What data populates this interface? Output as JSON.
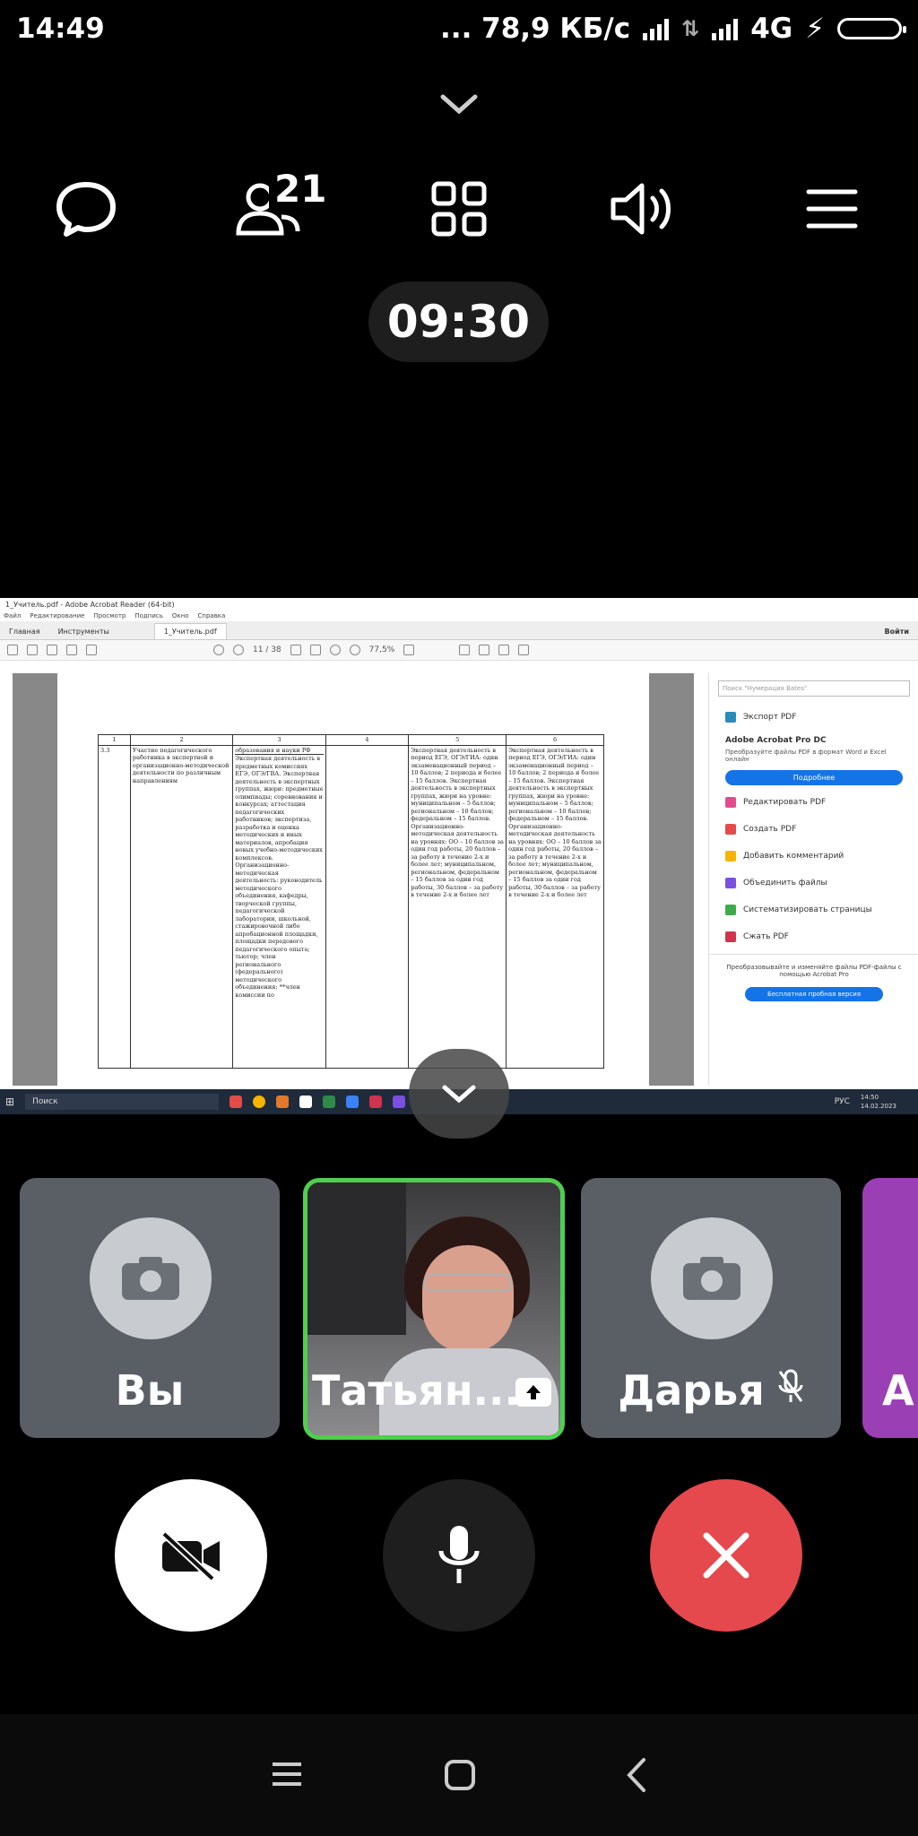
{
  "status": {
    "time": "14:49",
    "speed": "... 78,9 КБ/с",
    "network": "4G"
  },
  "call": {
    "participants_count": "21",
    "timer": "09:30"
  },
  "shared_screen": {
    "window_title": "1_Учитель.pdf - Adobe Acrobat Reader (64-bit)",
    "menu": [
      "Файл",
      "Редактирование",
      "Просмотр",
      "Подпись",
      "Окно",
      "Справка"
    ],
    "tabs": [
      "Главная",
      "Инструменты",
      "1_Учитель.pdf"
    ],
    "signin": "Войти",
    "page_indicator": "11 / 38",
    "zoom": "77,5%",
    "table": {
      "header": [
        "1",
        "2",
        "3",
        "4",
        "5",
        "6"
      ],
      "row_num": "3.3",
      "col2": "Участие педагогического работника в экспертной и организационно-методической деятельности по различным направлениям",
      "col3_top": "образования и науки РФ",
      "col3": "Экспертная деятельность в предметных комиссиях ЕГЭ, ОГЭ/ГВА. Экспертная деятельность в экспертных группах, жюри: предметные олимпиады; соревнования и конкурсах; аттестация педагогических работников; экспертиза, разработка и оценка методических и иных материалов, апробация новых учебно-методических комплексов. Организационно-методическая деятельность: руководитель методического объединения, кафедры, творческой группы, педагогической лаборатории, школьной, стажировочной либо апробационной площадки, площадки передового педагогического опыта; тьютор; член регионального (федерального) методического объединения; **член комиссии по",
      "col5": "Экспертная деятельность в период ЕГЭ, ОГЭ/ГИА: один экзаменационный период – 10 баллов; 2 периода и более – 15 баллов. Экспертная деятельность в экспертных группах, жюри на уровне: муниципальном – 5 баллов; региональном – 10 баллов; федеральном – 15 баллов. Организационно-методическая деятельность на уровнях: ОО – 10 баллов за один год работы, 20 баллов – за работу в течение 2-х и более лет; муниципальном, региональном, федеральном – 15 баллов за один год работы, 30 баллов – за работу в течение 2-х и более лет",
      "col6": "Экспертная деятельность в период ЕГЭ, ОГЭ/ГИА: один экзаменационный период – 10 баллов; 2 периода и более – 15 баллов. Экспертная деятельность в экспертных группах, жюри на уровне: муниципальном – 5 баллов; региональном – 10 баллов; федеральном – 15 баллов. Организационно-методическая деятельность на уровнях: ОО – 10 баллов за один год работы, 20 баллов – за работу в течение 2-х и более лет; муниципальном, региональном, федеральном – 15 баллов за один год работы, 30 баллов – за работу в течение 2-х и более лет"
    },
    "side_panel": {
      "search_placeholder": "Поиск \"Нумерация Bates\"",
      "export_label": "Экспорт PDF",
      "product": "Adobe Acrobat Pro DC",
      "product_desc": "Преобразуйте файлы PDF в формат Word и Excel онлайн",
      "more_button": "Подробнее",
      "items": [
        "Редактировать PDF",
        "Создать PDF",
        "Добавить комментарий",
        "Объединить файлы",
        "Систематизировать страницы",
        "Сжать PDF"
      ],
      "promo": "Преобразовывайте и изменяйте файлы PDF-файлы с помощью Acrobat Pro",
      "trial_button": "Бесплатная пробная версия"
    },
    "taskbar": {
      "search": "Поиск",
      "lang": "РУС",
      "clock_time": "14:50",
      "clock_date": "14.02.2023"
    }
  },
  "tiles": [
    {
      "name": "Вы"
    },
    {
      "name": "Татьян..."
    },
    {
      "name": "Дарья"
    },
    {
      "name": "А"
    }
  ],
  "colors": {
    "active_speaker": "#4fcf4f",
    "end_call": "#e5484d",
    "tile_bg": "#5a5f66",
    "purple_tile": "#9b3fb5"
  }
}
